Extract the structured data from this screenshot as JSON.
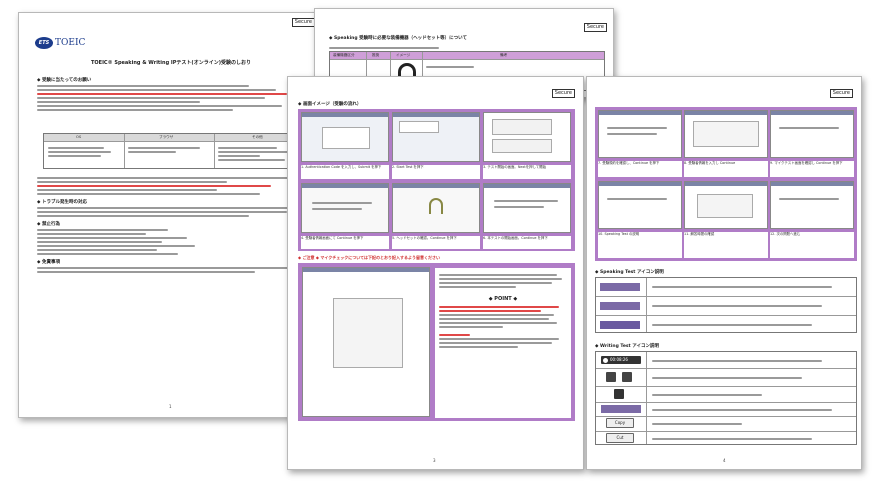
{
  "secure_label": "Secure",
  "page1": {
    "logo": "TOEIC",
    "title": "TOEIC® Speaking & Writing IPテスト(オンライン)受験のしおり",
    "sec1": "◆ 受験に当たってのお願い",
    "sec2": "◆ トラブル発生時の対応",
    "sec3": "◆ 禁止行為",
    "sec4": "◆ 免責事項",
    "table_headers": [
      "OS",
      "ブラウザ",
      "その他"
    ],
    "page_num": "1"
  },
  "page2": {
    "heading": "◆ Speaking 受験時に必要な装備機器（ヘッドセット等）について",
    "table_headers": [
      "装備機器区分",
      "推奨",
      "イメージ",
      "備考"
    ]
  },
  "page3": {
    "heading": "◆ 画面イメージ（受験の流れ）",
    "caps": [
      "1. Authentication Code を入力し、Submit を押下",
      "2. Start Test を押下",
      "3. テスト開始の画面。Nextを押して開始",
      "4. 受験者情報画面にて Continue を押下",
      "5. ヘッドセットの確認。Continue を押下",
      "6. 本テストの開始画面。Continue を押下"
    ],
    "note_title": "◆ ご注意 ◆ マイクチェックについては下記のとおり記入するよう留意ください",
    "point": "◆ POINT ◆",
    "page_num": "3"
  },
  "page4": {
    "caps": [
      "7. 受験規約を確認し、Continue を押下",
      "8. 受験者情報を入力し Continue",
      "9. マイクテスト画面を確認し Continue を押下",
      "10. Speaking Test の説明",
      "11. 解答時間の確認",
      "12. 次の問題へ進む"
    ],
    "speaking_heading": "◆ Speaking Test アイコン説明",
    "writing_heading": "◆ Writing Test アイコン説明",
    "timer": "00:08:26",
    "copy_label": "Copy",
    "cut_label": "Cut",
    "page_num": "4"
  },
  "colors": {
    "accent": "#b07cc7",
    "brand_blue": "#1c3c8c",
    "red": "#e04848"
  }
}
